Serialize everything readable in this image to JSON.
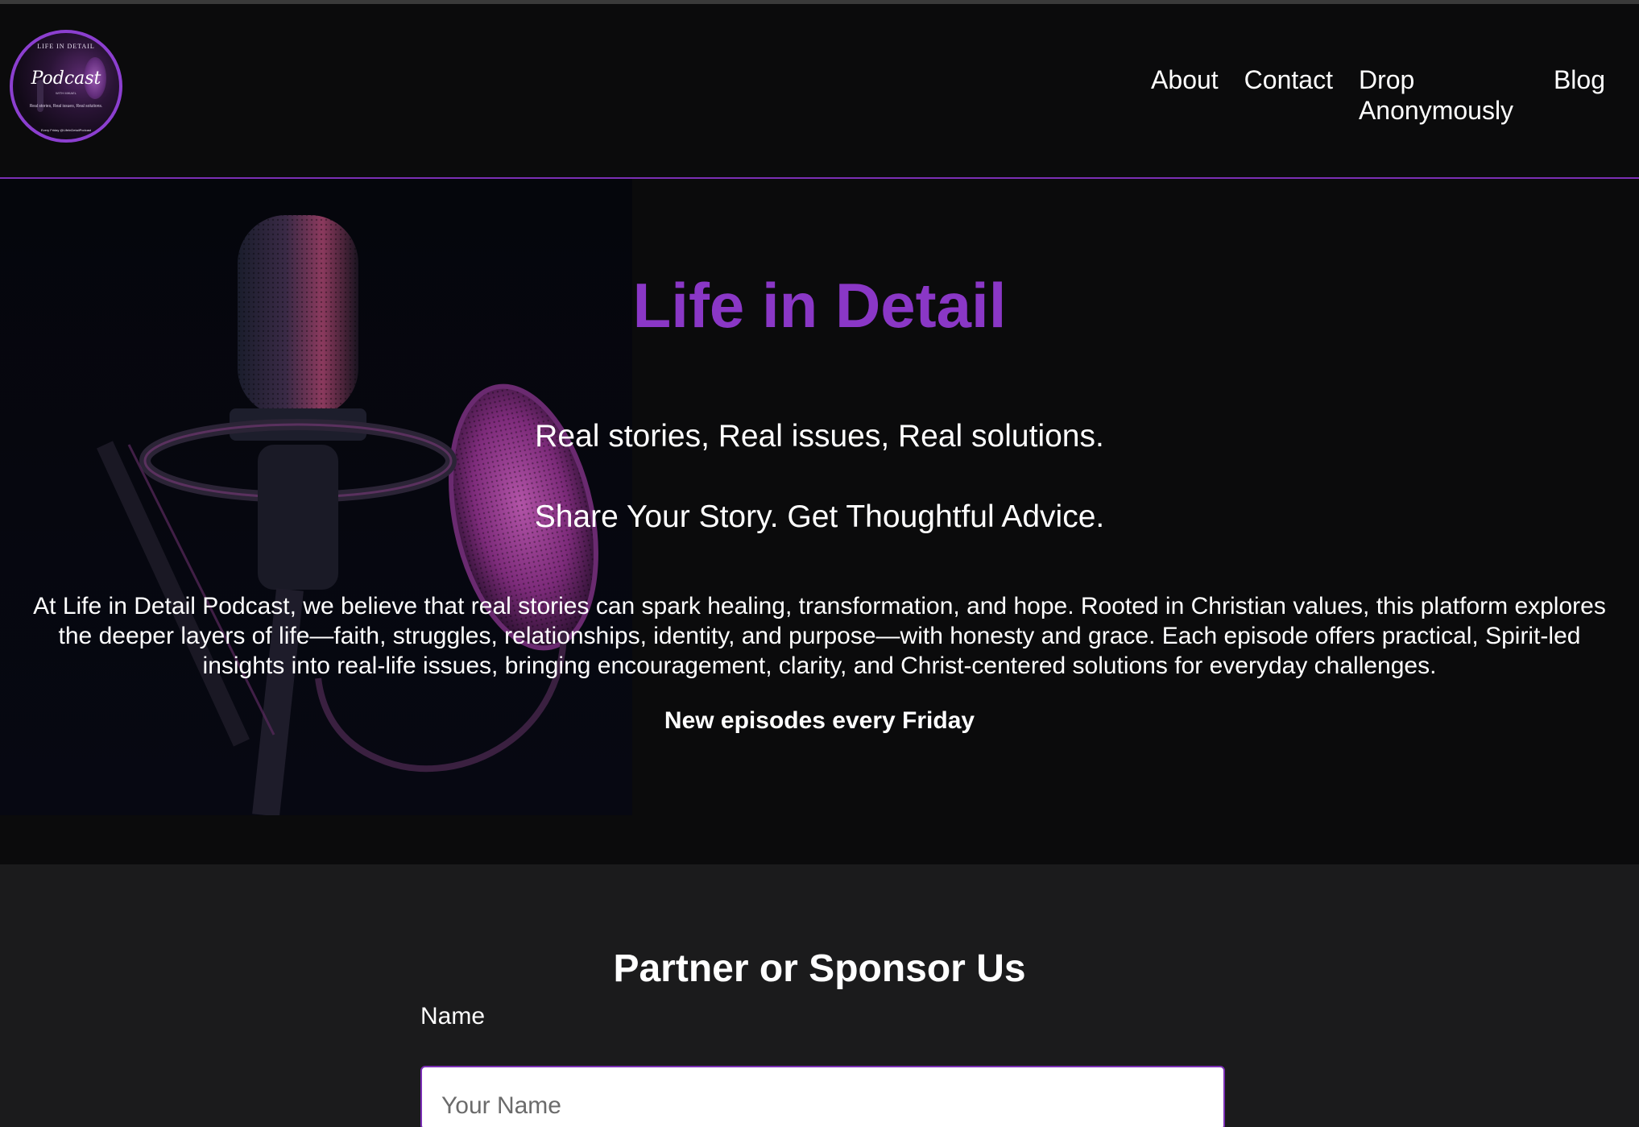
{
  "header": {
    "logo": {
      "top_text": "LIFE IN DETAIL",
      "script_text": "Podcast",
      "sub_text": "WITH MIKAEL",
      "tagline": "Real stories, Real issues, Real solutions.",
      "bottom_text": "Every Friday @LifeInDetailPodcast"
    },
    "nav": [
      {
        "label": "About"
      },
      {
        "label": "Contact"
      },
      {
        "label": "Drop Anonymously"
      },
      {
        "label": "Blog"
      }
    ]
  },
  "hero": {
    "title": "Life in Detail",
    "tagline_1": "Real stories, Real issues, Real solutions.",
    "tagline_2": "Share Your Story. Get Thoughtful Advice.",
    "body": "At Life in Detail Podcast, we believe that real stories can spark healing, transformation, and hope. Rooted in Christian values, this platform explores the deeper layers of life—faith, struggles, relationships, identity, and purpose—with honesty and grace. Each episode offers practical, Spirit-led insights into real-life issues, bringing encouragement, clarity, and Christ-centered solutions for everyday challenges.",
    "schedule": "New episodes every Friday"
  },
  "partner": {
    "heading": "Partner or Sponsor Us",
    "name_label": "Name",
    "name_placeholder": "Your Name",
    "name_value": ""
  },
  "colors": {
    "accent": "#8a37c6",
    "background": "#0b0b0c",
    "section_bg": "#1b1b1c"
  }
}
